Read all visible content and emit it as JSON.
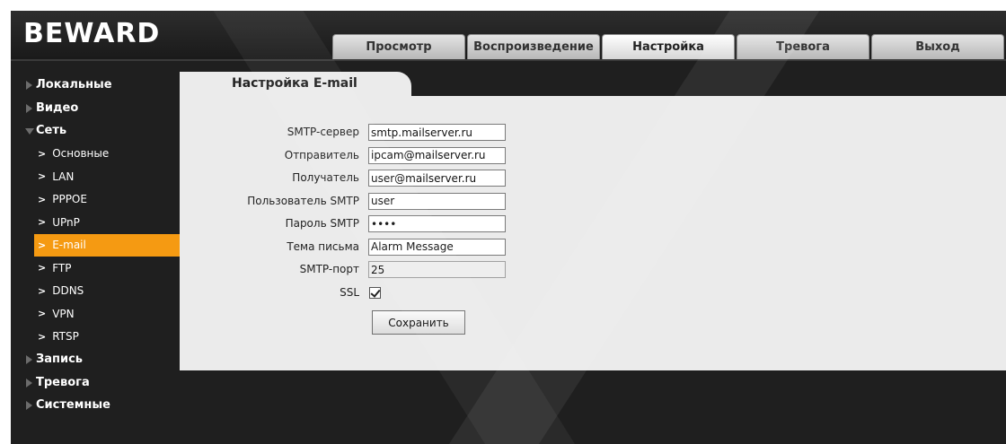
{
  "brand": {
    "logo_text": "BEWARD"
  },
  "tabs": [
    {
      "label": "Просмотр",
      "active": false
    },
    {
      "label": "Воспроизведение",
      "active": false
    },
    {
      "label": "Настройка",
      "active": true
    },
    {
      "label": "Тревога",
      "active": false
    },
    {
      "label": "Выход",
      "active": false
    }
  ],
  "sidebar": {
    "sections": [
      {
        "label": "Локальные",
        "expanded": false
      },
      {
        "label": "Видео",
        "expanded": false
      },
      {
        "label": "Сеть",
        "expanded": true
      },
      {
        "label": "Запись",
        "expanded": false
      },
      {
        "label": "Тревога",
        "expanded": false
      },
      {
        "label": "Системные",
        "expanded": false
      }
    ],
    "network_items": [
      {
        "label": "Основные"
      },
      {
        "label": "LAN"
      },
      {
        "label": "PPPOE"
      },
      {
        "label": "UPnP"
      },
      {
        "label": "E-mail",
        "active": true
      },
      {
        "label": "FTP"
      },
      {
        "label": "DDNS"
      },
      {
        "label": "VPN"
      },
      {
        "label": "RTSP"
      }
    ],
    "active_color": "#f59a12"
  },
  "content": {
    "tab_title": "Настройка E-mail",
    "fields": {
      "smtp_server": {
        "label": "SMTP-сервер",
        "value": "smtp.mailserver.ru"
      },
      "sender": {
        "label": "Отправитель",
        "value": "ipcam@mailserver.ru"
      },
      "recipient": {
        "label": "Получатель",
        "value": "user@mailserver.ru"
      },
      "smtp_user": {
        "label": "Пользователь SMTP",
        "value": "user"
      },
      "smtp_password": {
        "label": "Пароль SMTP",
        "value": "••••"
      },
      "subject": {
        "label": "Тема письма",
        "value": "Alarm Message"
      },
      "smtp_port": {
        "label": "SMTP-порт",
        "value": "25"
      },
      "ssl": {
        "label": "SSL",
        "checked": true
      }
    },
    "save_label": "Сохранить"
  }
}
